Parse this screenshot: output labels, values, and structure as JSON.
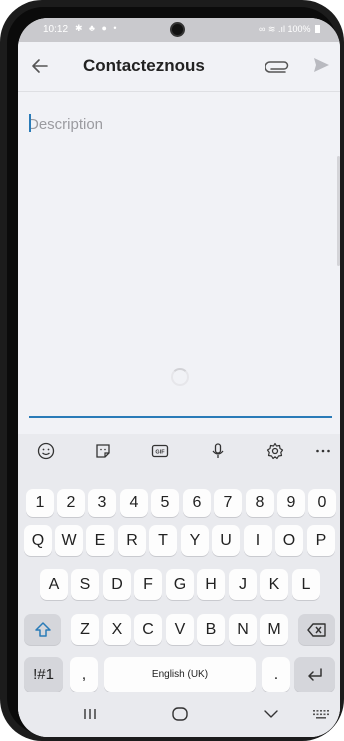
{
  "status": {
    "time": "10:12",
    "left_icons": "✱ ♣ ● •",
    "right_text": "∞ ≋ .ıl 100%"
  },
  "appbar": {
    "title": "Contacteznous",
    "icons": [
      "back-arrow-icon",
      "paperclip-icon",
      "send-icon"
    ]
  },
  "form": {
    "description_placeholder": "Description",
    "description_value": ""
  },
  "keyboard": {
    "toolbar": [
      "emoji-icon",
      "sticker-icon",
      "gif-icon",
      "microphone-icon",
      "settings-icon",
      "more-icon"
    ],
    "gif_label": "GIF",
    "numbers": [
      "1",
      "2",
      "3",
      "4",
      "5",
      "6",
      "7",
      "8",
      "9",
      "0"
    ],
    "row1": [
      "Q",
      "W",
      "E",
      "R",
      "T",
      "Y",
      "U",
      "I",
      "O",
      "P"
    ],
    "row2": [
      "A",
      "S",
      "D",
      "F",
      "G",
      "H",
      "J",
      "K",
      "L"
    ],
    "row3": [
      "Z",
      "X",
      "C",
      "V",
      "B",
      "N",
      "M"
    ],
    "symbols_label": "!#1",
    "comma": ",",
    "space_label": "English (UK)",
    "period": "."
  },
  "navbar": {
    "items": [
      "recent-apps-icon",
      "home-icon",
      "back-icon",
      "keyboard-icon"
    ]
  },
  "colors": {
    "accent": "#2a7bb8",
    "background": "#f1f2f6",
    "keyboard": "#e9eaee"
  }
}
